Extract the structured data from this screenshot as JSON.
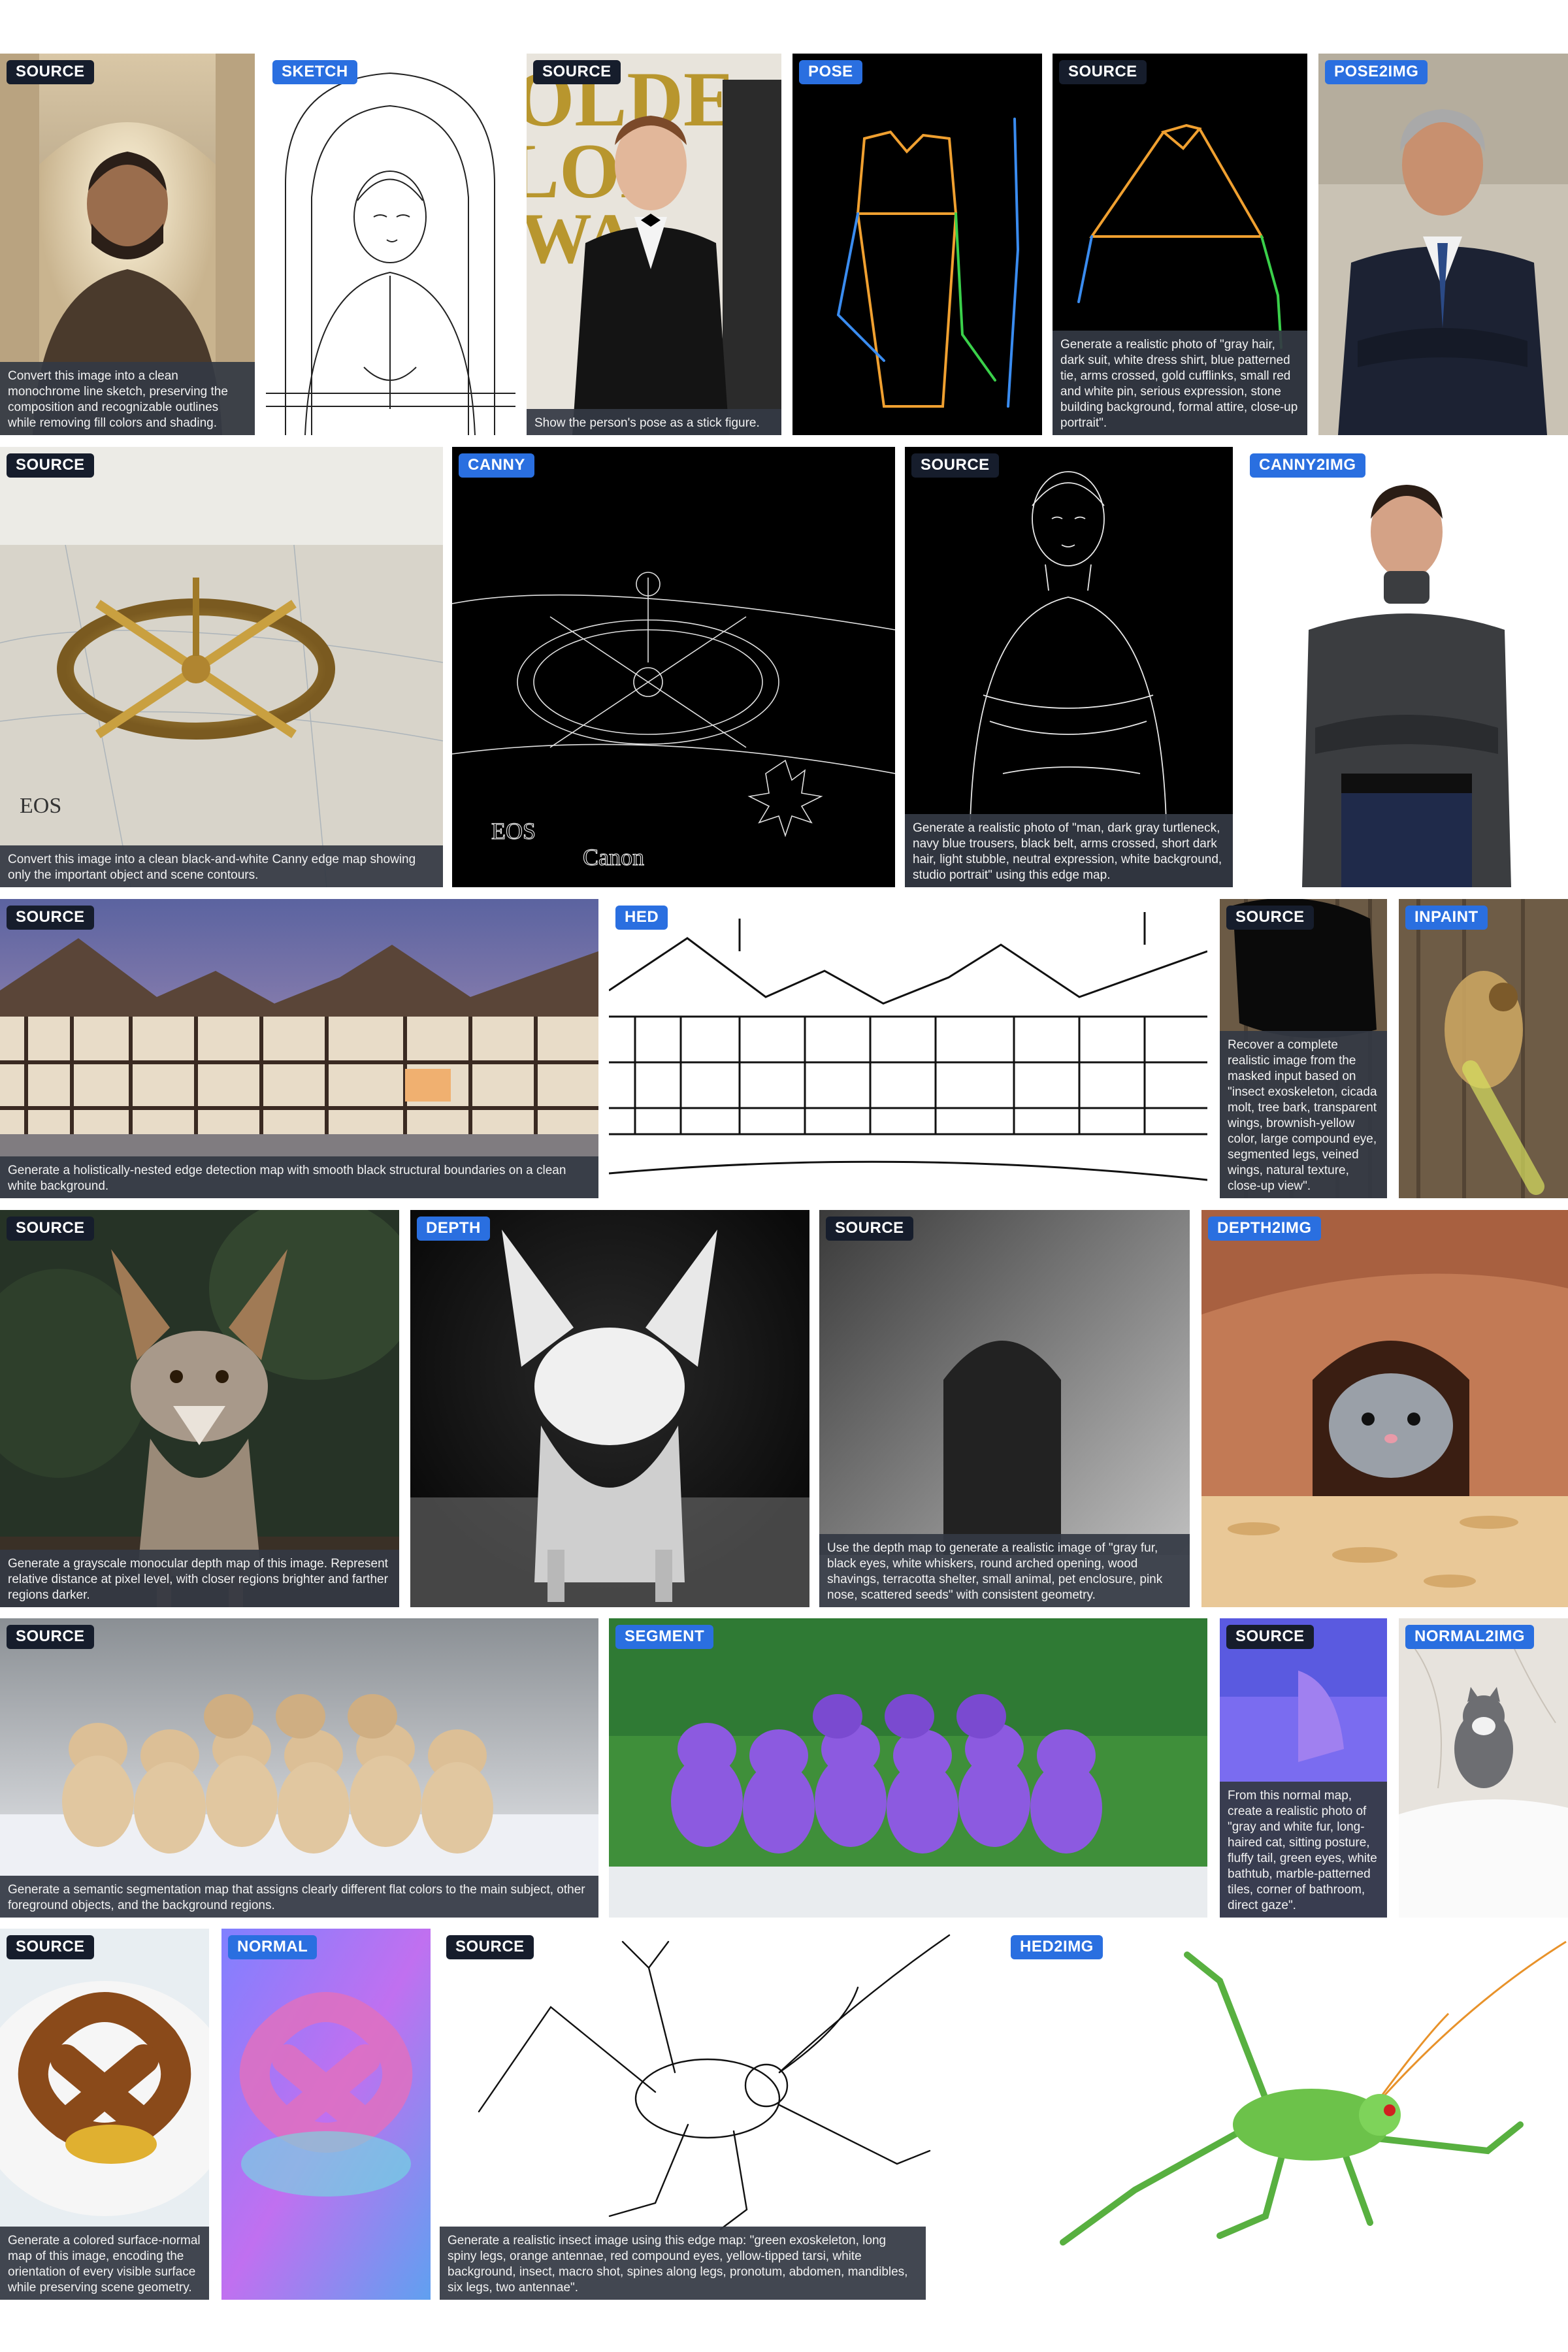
{
  "colors": {
    "source_tag": "#161d2c",
    "output_tag": "#2a6fe0",
    "caption_bg": "#343944"
  },
  "panels": [
    {
      "tag": "SOURCE",
      "kind": "src",
      "art": "courtyard-portrait",
      "caption": "Convert this image into a clean monochrome line sketch, preserving the composition and recognizable outlines while removing fill colors and shading."
    },
    {
      "tag": "SKETCH",
      "kind": "out",
      "art": "line-sketch",
      "caption": ""
    },
    {
      "tag": "SOURCE",
      "kind": "src",
      "art": "tuxedo-man",
      "caption": "Show the person's pose as a stick figure."
    },
    {
      "tag": "POSE",
      "kind": "out",
      "art": "pose-skeleton",
      "caption": ""
    },
    {
      "tag": "SOURCE",
      "kind": "src",
      "art": "pose-skeleton-2",
      "caption": "Generate a realistic photo of \"gray hair, dark suit, white dress shirt, blue patterned tie, arms crossed, gold cufflinks, small red and white pin, serious expression, stone building background, formal attire, close-up portrait\"."
    },
    {
      "tag": "POSE2IMG",
      "kind": "out",
      "art": "suit-man",
      "caption": ""
    },
    {
      "tag": "SOURCE",
      "kind": "src",
      "art": "brass-compass",
      "caption": "Convert this image into a clean black-and-white Canny edge map showing only the important object and scene contours."
    },
    {
      "tag": "CANNY",
      "kind": "out",
      "art": "canny-compass",
      "caption": ""
    },
    {
      "tag": "SOURCE",
      "kind": "src",
      "art": "canny-man",
      "caption": "Generate a realistic photo of \"man, dark gray turtleneck, navy blue trousers, black belt, arms crossed, short dark hair, light stubble, neutral expression, white background, studio portrait\" using this edge map."
    },
    {
      "tag": "CANNY2IMG",
      "kind": "out",
      "art": "turtleneck-man",
      "caption": ""
    },
    {
      "tag": "SOURCE",
      "kind": "src",
      "art": "tudor-houses",
      "caption": "Generate a holistically-nested edge detection map with smooth black structural boundaries on a clean white background."
    },
    {
      "tag": "HED",
      "kind": "out",
      "art": "hed-houses",
      "caption": ""
    },
    {
      "tag": "SOURCE",
      "kind": "src",
      "art": "masked-bark",
      "caption": "Recover a complete realistic image from the masked input based on \"insect exoskeleton, cicada molt, tree bark, transparent wings, brownish-yellow color, large compound eye, segmented legs, veined wings, natural texture, close-up view\"."
    },
    {
      "tag": "INPAINT",
      "kind": "out",
      "art": "cicada",
      "caption": ""
    },
    {
      "tag": "SOURCE",
      "kind": "src",
      "art": "fox",
      "caption": "Generate a grayscale monocular depth map of this image. Represent relative distance at pixel level, with closer regions brighter and farther regions darker."
    },
    {
      "tag": "DEPTH",
      "kind": "out",
      "art": "depth-fox",
      "caption": ""
    },
    {
      "tag": "SOURCE",
      "kind": "src",
      "art": "depth-arch",
      "caption": "Use the depth map to generate a realistic image of \"gray fur, black eyes, white whiskers, round arched opening, wood shavings, terracotta shelter, small animal, pet enclosure, pink nose, scattered seeds\" with consistent geometry."
    },
    {
      "tag": "DEPTH2IMG",
      "kind": "out",
      "art": "hamster",
      "caption": ""
    },
    {
      "tag": "SOURCE",
      "kind": "src",
      "art": "puppies",
      "caption": "Generate a semantic segmentation map that assigns clearly different flat colors to the main subject, other foreground objects, and the background regions."
    },
    {
      "tag": "SEGMENT",
      "kind": "out",
      "art": "seg-puppies",
      "caption": ""
    },
    {
      "tag": "SOURCE",
      "kind": "src",
      "art": "normal-map-cat",
      "caption": "From this normal map, create a realistic photo of \"gray and white fur, long-haired cat, sitting posture, fluffy tail, green eyes, white bathtub, marble-patterned tiles, corner of bathroom, direct gaze\"."
    },
    {
      "tag": "NORMAL2IMG",
      "kind": "out",
      "art": "cat-bathtub",
      "caption": ""
    },
    {
      "tag": "SOURCE",
      "kind": "src",
      "art": "pretzel",
      "caption": "Generate a colored surface-normal map of this image, encoding the orientation of every visible surface while preserving scene geometry."
    },
    {
      "tag": "NORMAL",
      "kind": "out",
      "art": "normal-pretzel",
      "caption": ""
    },
    {
      "tag": "SOURCE",
      "kind": "src",
      "art": "insect-sketch",
      "caption": "Generate a realistic insect image using this edge map: \"green exoskeleton, long spiny legs, orange antennae, red compound eyes, yellow-tipped tarsi, white background, insect, macro shot, spines along legs, pronotum, abdomen, mandibles, six legs, two antennae\"."
    },
    {
      "tag": "HED2IMG",
      "kind": "out",
      "art": "grasshopper",
      "caption": ""
    }
  ]
}
